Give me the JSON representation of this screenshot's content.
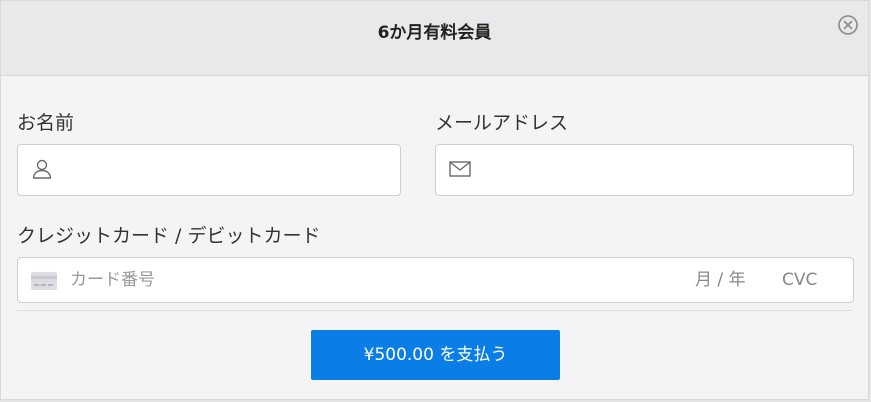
{
  "header": {
    "title": "6か月有料会員"
  },
  "form": {
    "name_label": "お名前",
    "email_label": "メールアドレス",
    "card_label": "クレジットカード / デビットカード",
    "card_number_placeholder": "カード番号",
    "expiry_placeholder": "月 / 年",
    "cvc_placeholder": "CVC"
  },
  "pay_button": {
    "label": "¥500.00 を支払う",
    "color": "#0a7de6"
  },
  "icons": {
    "close": "close-circle-icon",
    "name": "user-icon",
    "email": "envelope-icon",
    "card": "credit-card-icon"
  }
}
